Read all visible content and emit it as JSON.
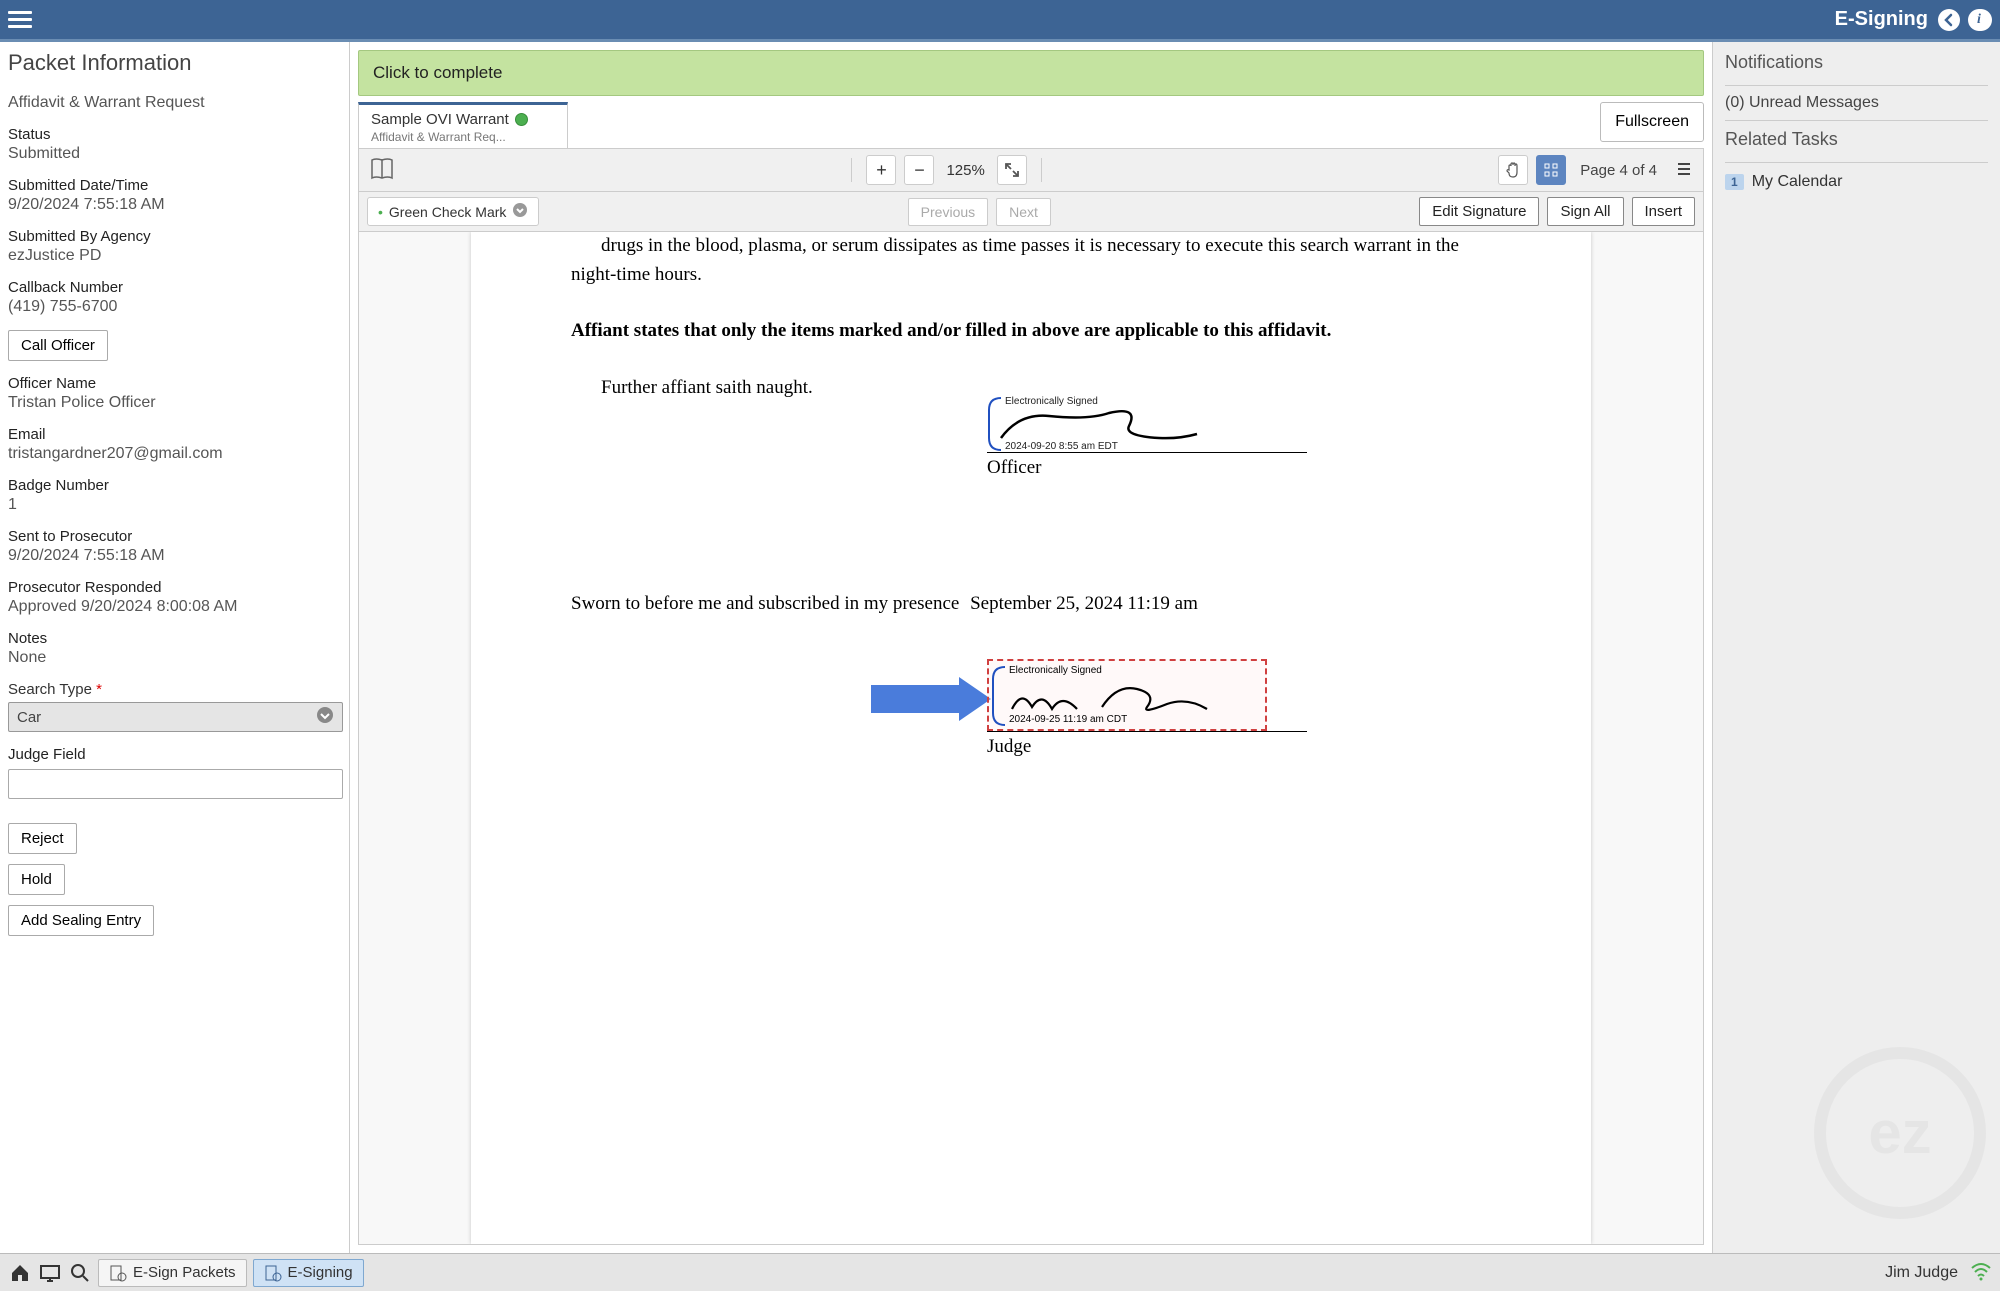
{
  "topbar": {
    "title": "E-Signing"
  },
  "leftPanel": {
    "title": "Packet Information",
    "fields": {
      "docType": "Affidavit & Warrant Request",
      "statusLabel": "Status",
      "status": "Submitted",
      "submittedDateLabel": "Submitted Date/Time",
      "submittedDate": "9/20/2024 7:55:18 AM",
      "submittedByLabel": "Submitted By Agency",
      "submittedBy": "ezJustice PD",
      "callbackLabel": "Callback Number",
      "callback": "(419) 755-6700",
      "callOfficer": "Call Officer",
      "officerNameLabel": "Officer Name",
      "officerName": "Tristan Police Officer",
      "emailLabel": "Email",
      "email": "tristangardner207@gmail.com",
      "badgeLabel": "Badge Number",
      "badge": "1",
      "sentProsLabel": "Sent to Prosecutor",
      "sentPros": "9/20/2024 7:55:18 AM",
      "prosRespLabel": "Prosecutor Responded",
      "prosResp": "Approved 9/20/2024 8:00:08 AM",
      "notesLabel": "Notes",
      "notes": "None",
      "searchTypeLabel": "Search Type",
      "searchType": "Car",
      "judgeFieldLabel": "Judge Field",
      "reject": "Reject",
      "hold": "Hold",
      "addSealing": "Add Sealing Entry"
    }
  },
  "center": {
    "completeBar": "Click to complete",
    "tab": {
      "title": "Sample OVI Warrant",
      "sub": "Affidavit & Warrant Req..."
    },
    "fullscreen": "Fullscreen",
    "toolbar": {
      "zoom": "125%",
      "pageInfo": "Page 4 of 4"
    },
    "toolbar2": {
      "stamp": "Green Check Mark",
      "previous": "Previous",
      "next": "Next",
      "editSig": "Edit Signature",
      "signAll": "Sign All",
      "insert": "Insert"
    },
    "document": {
      "line1": "drugs in the blood, plasma, or serum dissipates as time passes it is necessary to execute this search warrant in the night-time hours.",
      "line2": "Affiant states that only the items marked and/or filled in above are applicable to this affidavit.",
      "line3": "Further affiant saith naught.",
      "officerSig": {
        "esign": "Electronically Signed",
        "ts": "2024-09-20 8:55 am EDT",
        "role": "Officer"
      },
      "swornLine": "Sworn to before me and subscribed in my presence",
      "swornDate": "September 25, 2024 11:19 am",
      "judgeSig": {
        "esign": "Electronically Signed",
        "ts": "2024-09-25 11:19 am CDT",
        "role": "Judge"
      }
    }
  },
  "rightPanel": {
    "notifications": "Notifications",
    "unread": "(0) Unread Messages",
    "relatedTasks": "Related Tasks",
    "taskBadge": "1",
    "taskName": "My Calendar"
  },
  "bottomBar": {
    "tab1": "E-Sign Packets",
    "tab2": "E-Signing",
    "user": "Jim Judge"
  }
}
